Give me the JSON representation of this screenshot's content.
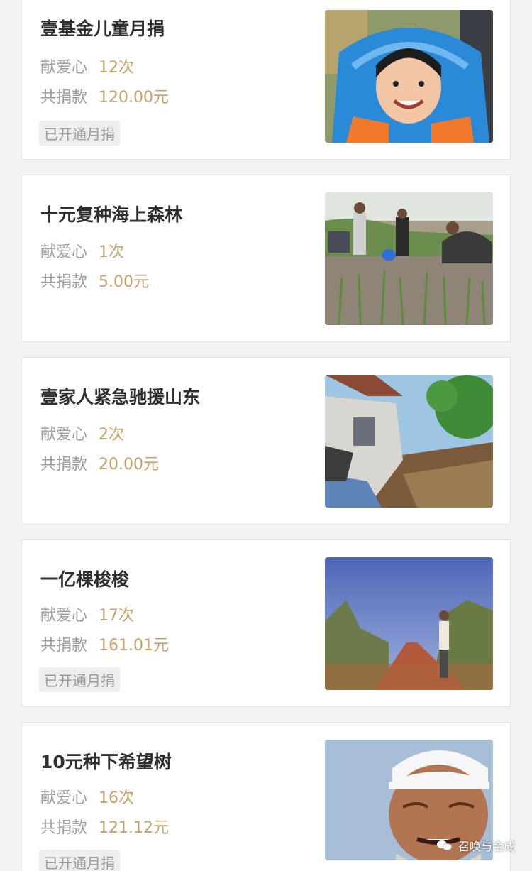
{
  "labels": {
    "love": "献爱心",
    "total": "共捐款",
    "monthly_badge": "已开通月捐"
  },
  "items": [
    {
      "title": "壹基金儿童月捐",
      "love_count": "12次",
      "donation": "120.00元",
      "monthly": true,
      "photo": "smiling-child-blue-jacket-photo"
    },
    {
      "title": "十元复种海上森林",
      "love_count": "1次",
      "donation": "5.00元",
      "monthly": false,
      "photo": "people-planting-seedlings-photo"
    },
    {
      "title": "壹家人紧急驰援山东",
      "love_count": "2次",
      "donation": "20.00元",
      "monthly": false,
      "photo": "collapsed-house-flood-photo"
    },
    {
      "title": "一亿棵梭梭",
      "love_count": "17次",
      "donation": "161.01元",
      "monthly": true,
      "photo": "man-standing-in-desert-shrubs-photo"
    },
    {
      "title": "10元种下希望树",
      "love_count": "16次",
      "donation": "121.12元",
      "monthly": true,
      "photo": "elderly-man-white-cap-photo"
    }
  ],
  "watermark": {
    "text": "召唤与合成",
    "icon": "wechat-icon"
  },
  "colors": {
    "title": "#2e2e2e",
    "label": "#9c9c9c",
    "value": "#c8a16a",
    "badge_bg": "#eeeeee",
    "card_border": "#e4e4e4",
    "page_bg": "#f3f3f3"
  }
}
